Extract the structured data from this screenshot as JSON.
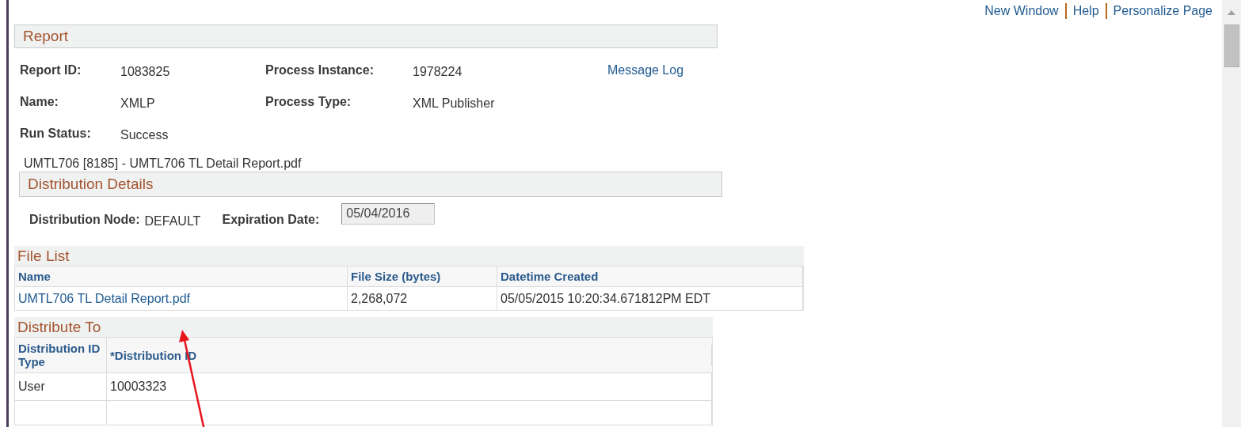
{
  "top_links": [
    "New Window",
    "Help",
    "Personalize Page"
  ],
  "report": {
    "title": "Report",
    "fields": [
      {
        "label": "Report ID:",
        "value": "1083825"
      },
      {
        "label": "Process Instance:",
        "value": "1978224"
      },
      {
        "label": "Name:",
        "value": "XMLP"
      },
      {
        "label": "Process Type:",
        "value": "XML Publisher"
      },
      {
        "label": "Run Status:",
        "value": "Success"
      }
    ],
    "message_log": "Message Log"
  },
  "file_caption": "UMTL706 [8185] - UMTL706 TL Detail Report.pdf",
  "distribution_details": {
    "title": "Distribution Details",
    "node_label": "Distribution Node:",
    "node_value": "DEFAULT",
    "expiration_label": "Expiration Date:",
    "expiration_value": "05/04/2016"
  },
  "file_list": {
    "title": "File List",
    "columns": [
      "Name",
      "File Size (bytes)",
      "Datetime Created"
    ],
    "rows": [
      {
        "name": "UMTL706 TL Detail Report.pdf",
        "size": "2,268,072",
        "created": "05/05/2015 10:20:34.671812PM EDT"
      }
    ]
  },
  "distribute_to": {
    "title": "Distribute To",
    "columns": [
      "Distribution ID Type",
      "*Distribution ID"
    ],
    "rows": [
      {
        "type": "User",
        "id": "10003323"
      }
    ]
  }
}
